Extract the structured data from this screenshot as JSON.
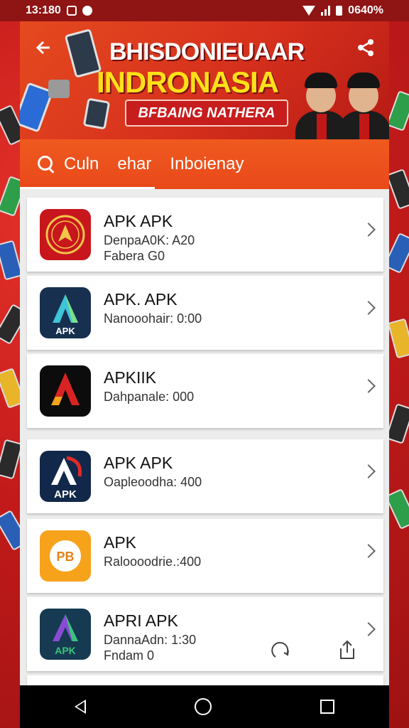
{
  "status_bar": {
    "time": "13:180",
    "notification_icons": [
      "app-square-icon",
      "record-dot-icon"
    ],
    "battery": "0640%"
  },
  "banner": {
    "title_line1": "BHISDONIEUAAR",
    "title_line2": "INDRONASIA",
    "ribbon": "BFBAING NATHERA",
    "colors": {
      "title1": "#ffffff",
      "title2": "#ffe11a",
      "banner": "#e54a1f"
    }
  },
  "search": {
    "text1": "Culn",
    "text2": "ehar",
    "text3": "Inboienay"
  },
  "apps": [
    {
      "name": "APK APK",
      "line1": "DenpaA0K: A20",
      "line2": "Fabera G0",
      "icon": "emblem-icon"
    },
    {
      "name": "APK. APK",
      "line1": "Nanooohair: 0:00",
      "line2": "",
      "icon": "apk-a-blue-icon",
      "icon_label": "APK"
    },
    {
      "name": "APKIIK",
      "line1": "Dahpanale: 000",
      "line2": "",
      "icon": "apk-a-red-icon"
    },
    {
      "name": "APK APK",
      "line1": "Oapleoodha: 400",
      "line2": "",
      "icon": "apk-a-navy-icon",
      "icon_label": "APK"
    },
    {
      "name": "APK",
      "line1": "Raloooodrie.:400",
      "line2": "",
      "icon": "pb-orange-icon",
      "icon_label": "PB"
    },
    {
      "name": "APRI APK",
      "line1": "DannaAdn: 1:30",
      "line2": "Fndam 0",
      "icon": "apk-a-purple-icon",
      "icon_label": "APK"
    }
  ],
  "nav": {
    "back": "back-icon",
    "home": "home-icon",
    "recent": "recent-apps-icon"
  }
}
